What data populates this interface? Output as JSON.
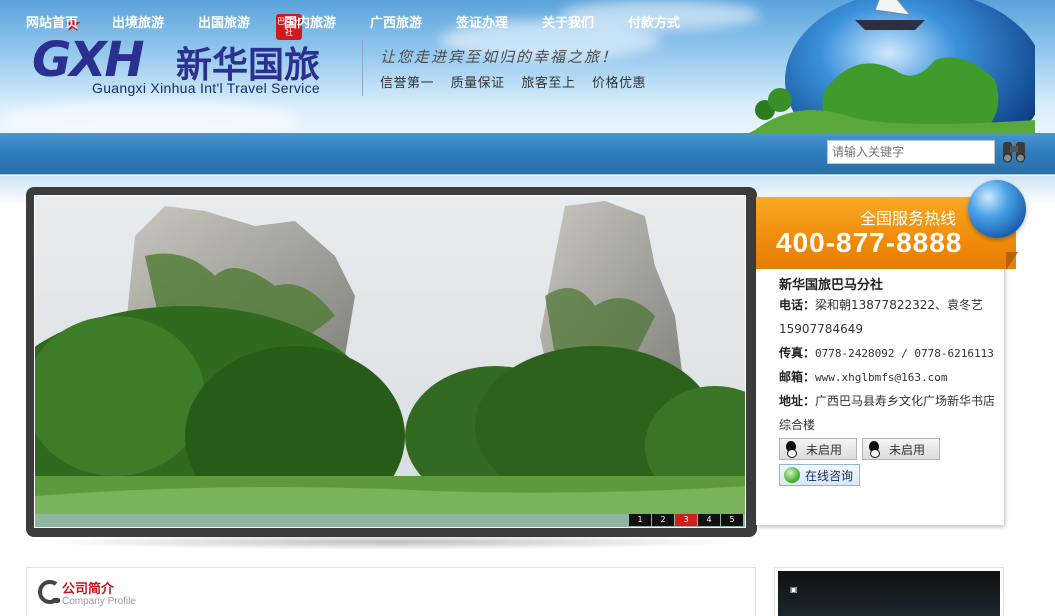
{
  "header": {
    "logo_mark": "GXH",
    "logo_cn": "新华国旅",
    "logo_stamp": "巴马分社",
    "logo_en": "Guangxi Xinhua Int'l Travel Service",
    "slogan": "让您走进宾至如归的幸福之旅！",
    "tags": [
      "信誉第一",
      "质量保证",
      "旅客至上",
      "价格优惠"
    ]
  },
  "nav": {
    "items": [
      "网站首页",
      "出境旅游",
      "出国旅游",
      "国内旅游",
      "广西旅游",
      "签证办理",
      "关于我们",
      "付款方式"
    ],
    "search_placeholder": "请输入关键字",
    "search_icon": "binoculars-icon"
  },
  "slider": {
    "pages": [
      "1",
      "2",
      "3",
      "4",
      "5"
    ],
    "active_page": "3"
  },
  "contact": {
    "hotline_label": "全国服务热线",
    "hotline_number": "400-877-8888",
    "company": "新华国旅巴马分社",
    "phone_label": "电话：",
    "phone_value": "梁和朝13877822322、袁冬艺",
    "phone_value2": "15907784649",
    "fax_label": "传真：",
    "fax_value": "0778-2428092 / 0778-6216113",
    "email_label": "邮箱：",
    "email_value": "www.xhglbmfs@163.com",
    "address_label": "地址：",
    "address_value": "广西巴马县寿乡文化广场新华书店",
    "address_value2": "综合楼",
    "qq_buttons": [
      "未启用",
      "未启用"
    ],
    "online_button": "在线咨询"
  },
  "about": {
    "title": "公司简介",
    "subtitle": "Company Profile"
  },
  "colors": {
    "nav_blue": "#2f7cbb",
    "hotline_orange": "#f08c0a",
    "accent_red": "#c8151d"
  }
}
